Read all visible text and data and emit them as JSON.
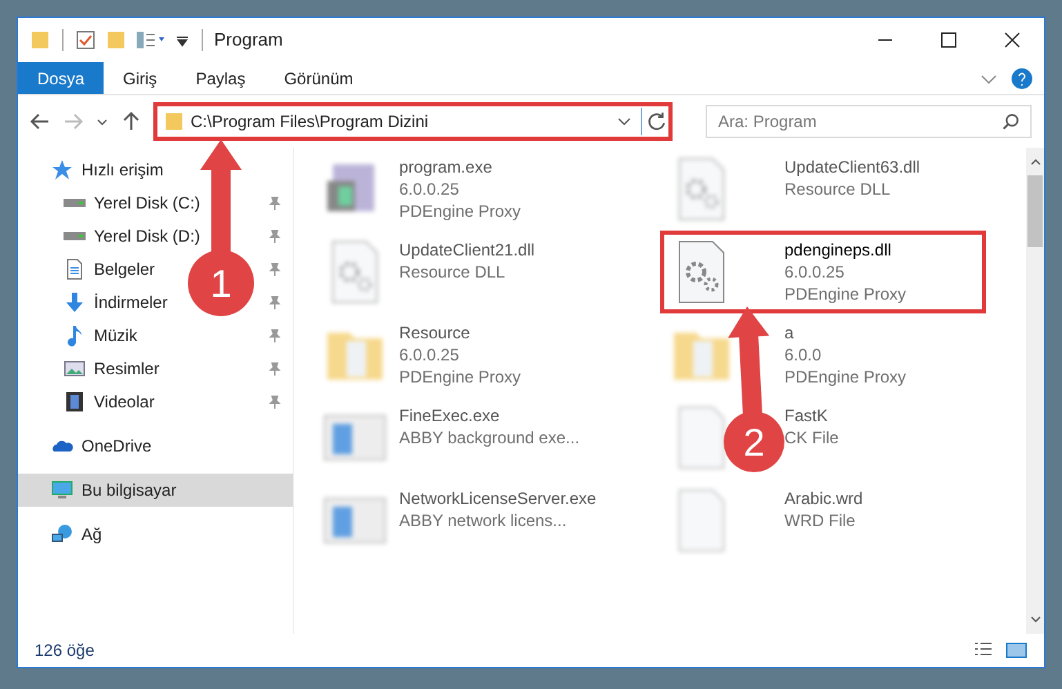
{
  "window": {
    "title": "Program"
  },
  "ribbon_tabs": [
    {
      "label": "Dosya",
      "selected": true
    },
    {
      "label": "Giriş",
      "selected": false
    },
    {
      "label": "Paylaş",
      "selected": false
    },
    {
      "label": "Görünüm",
      "selected": false
    }
  ],
  "address_bar": {
    "path": "C:\\Program Files\\Program Dizini",
    "highlighted": true
  },
  "search": {
    "placeholder": "Ara: Program"
  },
  "sidebar": {
    "items": [
      {
        "label": "Hızlı erişim",
        "kind": "star",
        "pinned": false,
        "selected": false,
        "children": [
          {
            "label": "Yerel Disk (C:)",
            "kind": "drive",
            "pinned": true,
            "selected": false
          },
          {
            "label": "Yerel Disk (D:)",
            "kind": "drive",
            "pinned": true,
            "selected": false
          },
          {
            "label": "Belgeler",
            "kind": "docs",
            "pinned": true,
            "selected": false
          },
          {
            "label": "İndirmeler",
            "kind": "download",
            "pinned": true,
            "selected": false
          },
          {
            "label": "Müzik",
            "kind": "music",
            "pinned": true,
            "selected": false
          },
          {
            "label": "Resimler",
            "kind": "pictures",
            "pinned": true,
            "selected": false
          },
          {
            "label": "Videolar",
            "kind": "video",
            "pinned": true,
            "selected": false
          }
        ]
      },
      {
        "label": "OneDrive",
        "kind": "cloud",
        "pinned": false,
        "selected": false
      },
      {
        "label": "Bu bilgisayar",
        "kind": "pc",
        "pinned": false,
        "selected": true
      },
      {
        "label": "Ağ",
        "kind": "network",
        "pinned": false,
        "selected": false
      }
    ]
  },
  "files": [
    {
      "name": "program.exe",
      "lines": [
        "6.0.0.25",
        "PDEngine Proxy"
      ],
      "kind": "exe",
      "blurred": true,
      "highlighted": false
    },
    {
      "name": "UpdateClient63.dll",
      "lines": [
        "Resource DLL"
      ],
      "kind": "dll",
      "blurred": true,
      "highlighted": false
    },
    {
      "name": "UpdateClient21.dll",
      "lines": [
        "Resource DLL"
      ],
      "kind": "dll",
      "blurred": true,
      "highlighted": false
    },
    {
      "name": "pdengineps.dll",
      "lines": [
        "6.0.0.25",
        "PDEngine Proxy"
      ],
      "kind": "dll",
      "blurred": false,
      "highlighted": true
    },
    {
      "name": "Resource",
      "lines": [
        "6.0.0.25",
        "PDEngine Proxy"
      ],
      "kind": "folder",
      "blurred": true,
      "highlighted": false
    },
    {
      "name": "a",
      "lines": [
        "6.0.0",
        "PDEngine Proxy"
      ],
      "kind": "folder",
      "blurred": true,
      "highlighted": false
    },
    {
      "name": "FineExec.exe",
      "lines": [
        "ABBY background exe..."
      ],
      "kind": "app",
      "blurred": true,
      "highlighted": false
    },
    {
      "name": "FastK",
      "lines": [
        "CK File"
      ],
      "kind": "blank",
      "blurred": true,
      "highlighted": false
    },
    {
      "name": "NetworkLicenseServer.exe",
      "lines": [
        "ABBY network licens..."
      ],
      "kind": "app",
      "blurred": true,
      "highlighted": false
    },
    {
      "name": "Arabic.wrd",
      "lines": [
        "WRD File"
      ],
      "kind": "blank",
      "blurred": true,
      "highlighted": false
    }
  ],
  "status_bar": {
    "count": "126 öğe"
  },
  "annotations": [
    {
      "label": "1"
    },
    {
      "label": "2"
    }
  ]
}
